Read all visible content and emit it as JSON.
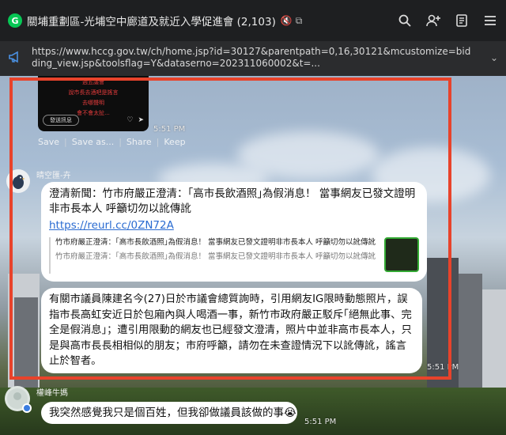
{
  "header": {
    "app_badge": "G",
    "title": "關埔重劃區-光埔空中廊道及就近入學促進會 (2,103)",
    "mute_icon": "bell-slash-icon",
    "popout_icon": "popout-icon",
    "actions": [
      "search-icon",
      "add-user-icon",
      "notes-icon",
      "menu-icon"
    ]
  },
  "announcement": {
    "icon": "megaphone-icon",
    "url": "https://www.hccg.gov.tw/ch/home.jsp?id=30127&parentpath=0,16,30121&mcustomize=bidding_view.jsp&toolsflag=Y&dataserno=202311060002&t=..."
  },
  "media_card": {
    "overlay_lines": [
      "週五議會",
      "說市長去酒吧是謠言",
      "去哪聲明",
      "會不會太扯..."
    ],
    "send_label": "發送訊息"
  },
  "messages": {
    "media_time": "5:51 PM",
    "save_actions": [
      "Save",
      "Save as...",
      "Share",
      "Keep"
    ],
    "sender1": "晴空匯-卉",
    "bubble1_text": "澄清新聞：竹市府嚴正澄清：｢高市長飲酒照｣為假消息！ 當事網友已發文證明非市長本人 呼籲切勿以訛傳訛",
    "bubble1_link": "https://reurl.cc/0ZN72A",
    "preview_title": "竹市府嚴正澄清：｢高市長飲酒照｣為假消息！ 當事網友已發文證明非市長本人 呼籲切勿以訛傳訛",
    "preview_desc": "竹市府嚴正澄清：｢高市長飲酒照｣為假消息！ 當事網友已發文證明非市長本人 呼籲切勿以訛傳訛",
    "bubble2_text": "有關市議員陳建名今(27)日於市議會總質詢時，引用網友IG限時動態照片，誤指市長高虹安近日於包廂內與人喝酒一事，新竹市政府嚴正駁斥｢絕無此事、完全是假消息｣；遭引用限動的網友也已經發文澄清，照片中並非高市長本人，只是與高市長長相相似的朋友；市府呼籲，請勿在未查證情況下以訛傳訛，謠言止於智者。",
    "time2": "5:51 PM",
    "sender2": "權峰牛媽",
    "bubble3_text": "我突然感覺我只是個百姓，但我卻做議員該做的事😭",
    "time3": "5:51 PM"
  },
  "colors": {
    "highlight": "#e8432b",
    "link": "#2a6bd1",
    "line_green": "#06c755"
  }
}
